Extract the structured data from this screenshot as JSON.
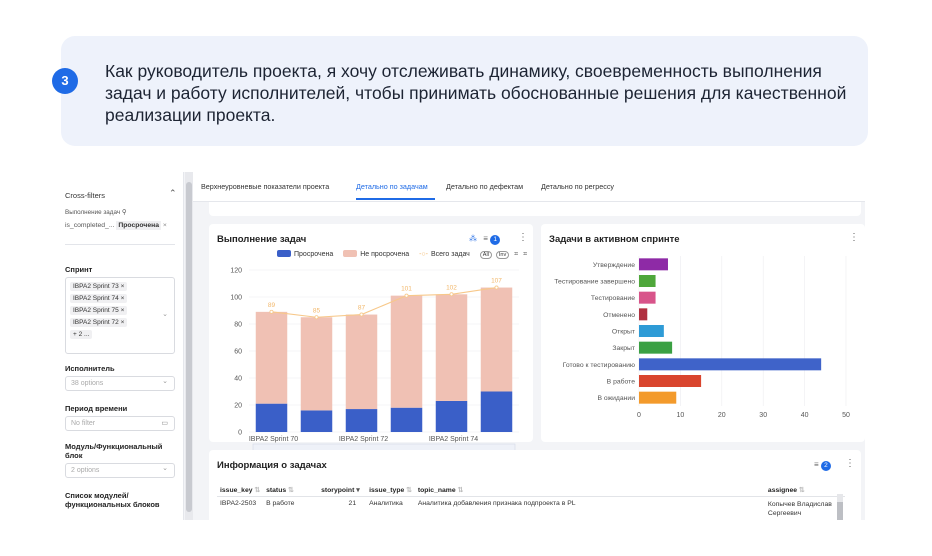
{
  "story": {
    "number": "3",
    "text": "Как руководитель проекта, я хочу отслеживать динамику, своевременность выполнения задач и работу исполнителей, чтобы принимать обоснованные решения для качественной реализации проекта."
  },
  "filters": {
    "title": "Cross-filters",
    "crossfilter_label": "Выполнение задач",
    "crossfilter_key": "is_completed_...",
    "crossfilter_value": "Просрочена",
    "sprint_label": "Спринт",
    "sprints": [
      "IBPA2 Sprint 73",
      "IBPA2 Sprint 74",
      "IBPA2 Sprint 75",
      "IBPA2 Sprint 72"
    ],
    "sprints_more": "+ 2 ...",
    "assignee_label": "Исполнитель",
    "assignee_placeholder": "38 options",
    "period_label": "Период времени",
    "period_placeholder": "No filter",
    "module_label": "Модуль/Функциональный блок",
    "module_placeholder": "2 options",
    "modules_list_label": "Список модулей/ функциональных блоков"
  },
  "tabs": [
    "Верхнеуровневые показатели проекта",
    "Детально по задачам",
    "Детально по дефектам",
    "Детально по регрессу"
  ],
  "exec_card": {
    "title": "Выполнение задач",
    "filter_count": "1",
    "legend_overdue": "Просрочена",
    "legend_ontime": "Не просрочена",
    "legend_total": "Всего задач",
    "btn_all": "All",
    "btn_inv": "Inv"
  },
  "sprint_card": {
    "title": "Задачи в активном спринте"
  },
  "issues_card": {
    "title": "Информация о задачах",
    "filter_count": "2",
    "columns": [
      "issue_key",
      "status",
      "storypoint",
      "issue_type",
      "topic_name",
      "assignee"
    ],
    "rows": [
      {
        "issue_key": "IBPA2-2503",
        "status": "В работе",
        "storypoint": "21",
        "issue_type": "Аналитика",
        "topic_name": "Аналитика добавления признака подпроекта в PL",
        "assignee": "Копычев Владислав Сергеевич"
      }
    ]
  },
  "colors": {
    "accent": "#1f6be6",
    "overdue": "#3a5fc8",
    "ontime": "#f0c1b4",
    "total_line": "#f7c88a"
  },
  "chart_data": [
    {
      "type": "bar",
      "stacked": true,
      "categories": [
        "IBPA2 Sprint 70",
        "",
        "IBPA2 Sprint 72",
        "",
        "IBPA2 Sprint 74",
        ""
      ],
      "series": [
        {
          "name": "Просрочена",
          "values": [
            21,
            16,
            17,
            18,
            23,
            30
          ]
        },
        {
          "name": "Не просрочена",
          "values": [
            68,
            69,
            70,
            83,
            79,
            77
          ]
        },
        {
          "name": "Всего задач",
          "type": "line",
          "values": [
            89,
            85,
            87,
            101,
            102,
            107
          ]
        }
      ],
      "data_labels": [
        "89",
        "85",
        "87",
        "101",
        "102",
        "107"
      ],
      "ylim": [
        0,
        120
      ],
      "yticks": [
        0,
        20,
        40,
        60,
        80,
        100,
        120
      ],
      "grid": true
    },
    {
      "type": "bar",
      "orientation": "horizontal",
      "categories": [
        "Утверждение",
        "Тестирование завершено",
        "Тестирование",
        "Отменено",
        "Открыт",
        "Закрыт",
        "Готово к тестированию",
        "В работе",
        "В ожидании"
      ],
      "values": [
        7,
        4,
        4,
        2,
        6,
        8,
        44,
        15,
        9
      ],
      "colors": [
        "#8e2aa6",
        "#4fa73b",
        "#d8548a",
        "#b03040",
        "#2e9bd6",
        "#3aa043",
        "#3f63c9",
        "#d9452e",
        "#f39a2b"
      ],
      "xlim": [
        0,
        50
      ],
      "xticks": [
        0,
        10,
        20,
        30,
        40,
        50
      ],
      "grid": true
    }
  ]
}
